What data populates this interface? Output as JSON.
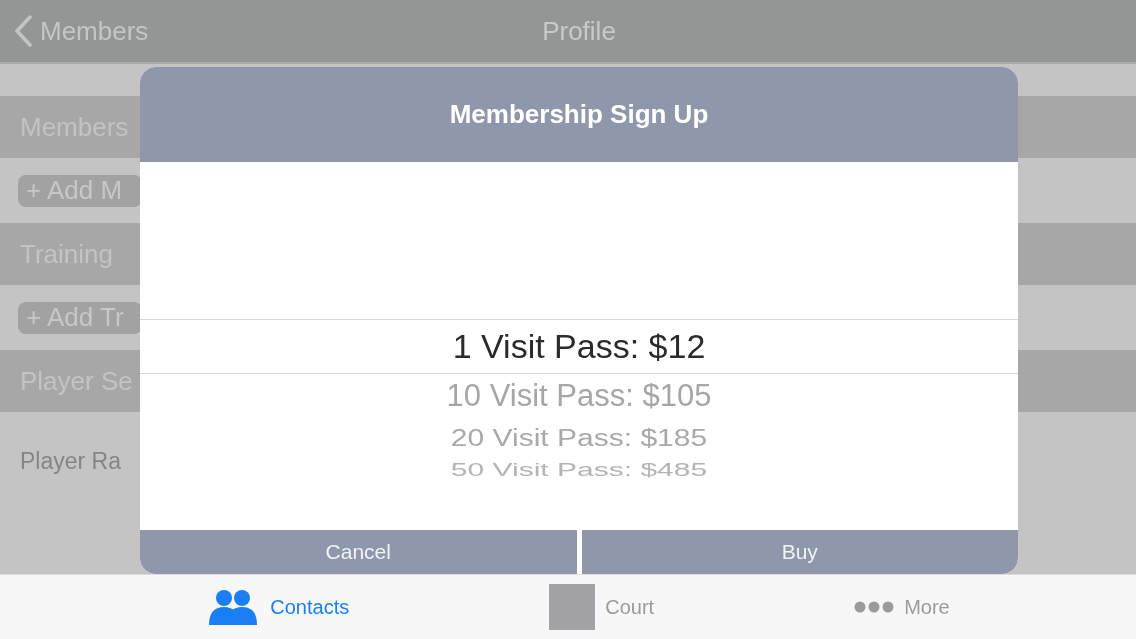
{
  "nav_bar": {
    "back_label": "Members",
    "title": "Profile"
  },
  "profile_list": {
    "rows": [
      {
        "kind": "header",
        "label": "Members"
      },
      {
        "kind": "button",
        "label": "+ Add M"
      },
      {
        "kind": "header",
        "label": "Training"
      },
      {
        "kind": "button",
        "label": "+ Add Tr"
      },
      {
        "kind": "header",
        "label": "Player Se"
      },
      {
        "kind": "text",
        "label": "Player Ra"
      }
    ]
  },
  "dialog": {
    "title": "Membership Sign Up",
    "picker": {
      "options": [
        {
          "label": "1 Visit Pass: $12",
          "selected": true
        },
        {
          "label": "10 Visit Pass: $105",
          "selected": false
        },
        {
          "label": "20 Visit Pass: $185",
          "selected": false
        },
        {
          "label": "50 Visit Pass: $485",
          "selected": false
        }
      ]
    },
    "buttons": [
      {
        "label": "Cancel"
      },
      {
        "label": "Buy"
      }
    ]
  },
  "tab_bar": {
    "tabs": [
      {
        "label": "Contacts",
        "selected": true
      },
      {
        "label": "Court",
        "selected": false
      },
      {
        "label": "More",
        "selected": false
      }
    ]
  }
}
